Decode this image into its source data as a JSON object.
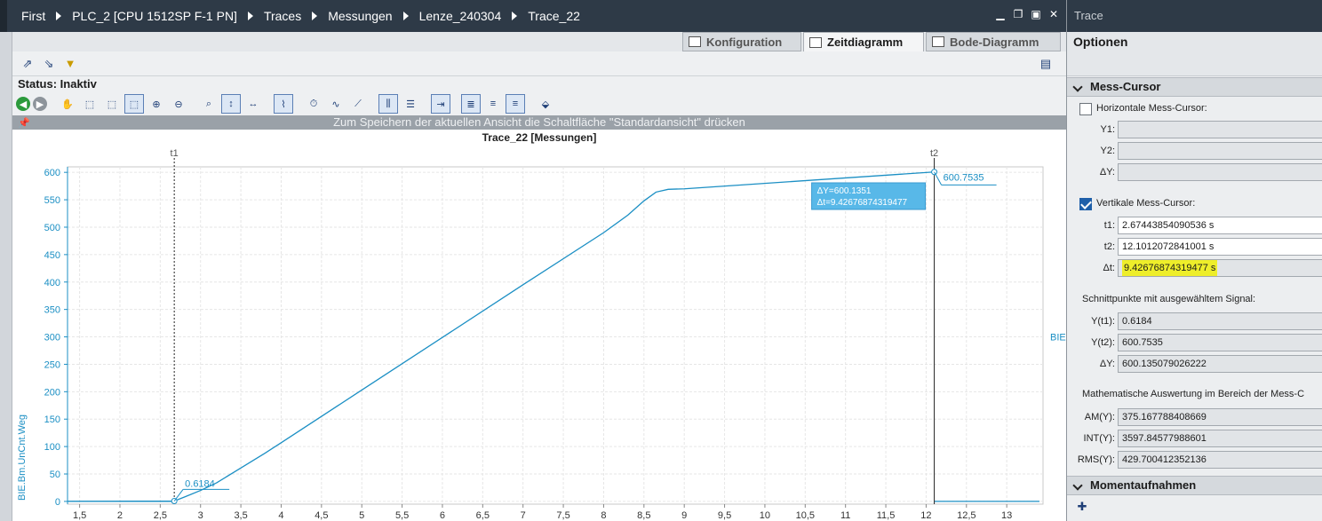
{
  "breadcrumb": [
    "First",
    "PLC_2 [CPU 1512SP F-1 PN]",
    "Traces",
    "Messungen",
    "Lenze_240304",
    "Trace_22"
  ],
  "tabs": [
    {
      "label": "Konfiguration",
      "active": false
    },
    {
      "label": "Zeitdiagramm",
      "active": true
    },
    {
      "label": "Bode-Diagramm",
      "active": false
    }
  ],
  "status": "Status: Inaktiv",
  "info_banner": "Zum Speichern der aktuellen Ansicht die Schaltfläche \"Standardansicht\" drücken",
  "right_panel": {
    "title": "Trace",
    "options_label": "Optionen",
    "mess_cursor": {
      "section_title": "Mess-Cursor",
      "horizontal_label": "Horizontale Mess-Cursor:",
      "horizontal_checked": false,
      "y1_label": "Y1:",
      "y1": "",
      "y2_label": "Y2:",
      "y2": "",
      "dy_label": "ΔY:",
      "dy": "",
      "vertical_label": "Vertikale Mess-Cursor:",
      "vertical_checked": true,
      "t1_label": "t1:",
      "t1": "2.67443854090536 s",
      "t2_label": "t2:",
      "t2": "12.1012072841001 s",
      "dt_label": "Δt:",
      "dt": "9.42676874319477 s",
      "intersect_label": "Schnittpunkte mit ausgewähltem Signal:",
      "yt1_label": "Y(t1):",
      "yt1": "0.6184",
      "yt2_label": "Y(t2):",
      "yt2": "600.7535",
      "dY_label": "ΔY:",
      "dY": "600.135079026222",
      "math_label": "Mathematische Auswertung im Bereich der Mess-C",
      "am_label": "AM(Y):",
      "am": "375.167788408669",
      "int_label": "INT(Y):",
      "int": "3597.84577988601",
      "rms_label": "RMS(Y):",
      "rms": "429.700412352136"
    },
    "snapshots_title": "Momentaufnahmen"
  },
  "chart_data": {
    "type": "line",
    "title": "Trace_22 [Messungen]",
    "ylabel": "BIE.Bm.UnCnt.Weg",
    "xlim": [
      1.35,
      13.45
    ],
    "ylim": [
      -5,
      610
    ],
    "xticks": [
      "1,5",
      "2",
      "2,5",
      "3",
      "3,5",
      "4",
      "4,5",
      "5",
      "5,5",
      "6",
      "6,5",
      "7",
      "7,5",
      "8",
      "8,5",
      "9",
      "9,5",
      "10",
      "10,5",
      "11",
      "11,5",
      "12",
      "12,5",
      "13"
    ],
    "yticks": [
      "0",
      "50",
      "100",
      "150",
      "200",
      "250",
      "300",
      "350",
      "400",
      "450",
      "500",
      "550",
      "600"
    ],
    "grid": true,
    "series": [
      {
        "name": "BIE.Bm.UnCnt.Weg",
        "color": "#1b8fc4",
        "x": [
          1.35,
          2.674,
          2.8,
          3.0,
          3.2,
          3.4,
          3.6,
          3.8,
          4.0,
          5.0,
          6.0,
          7.0,
          8.0,
          8.3,
          8.5,
          8.65,
          8.8,
          9.0,
          12.1
        ],
        "y": [
          0,
          0.6184,
          8,
          20,
          34,
          52,
          70,
          88,
          107,
          203,
          299,
          395,
          490,
          522,
          548,
          564,
          569,
          570,
          600.7535
        ]
      }
    ],
    "cursors": [
      {
        "label": "t1",
        "x": 2.674,
        "value_label": "0.6184"
      },
      {
        "label": "t2",
        "x": 12.101,
        "value_label": "600.7535"
      }
    ],
    "delta_box": [
      "ΔY=600.1351",
      "Δt=9.42676874319477"
    ]
  }
}
